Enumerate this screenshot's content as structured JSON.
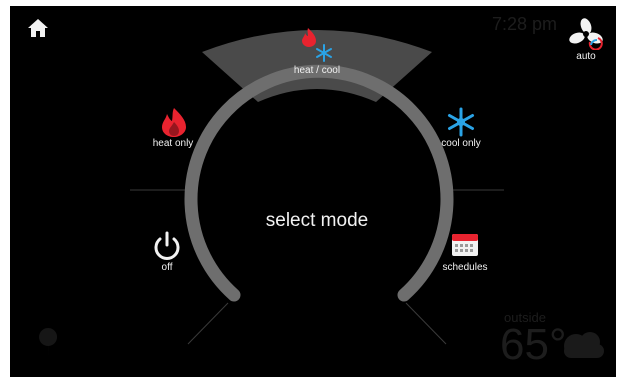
{
  "center_title": "select mode",
  "modes": {
    "heat_cool": "heat / cool",
    "heat_only": "heat only",
    "cool_only": "cool only",
    "off": "off",
    "schedules": "schedules"
  },
  "fan": {
    "label": "auto"
  },
  "background": {
    "time": "7:28 pm",
    "outside_label": "outside",
    "outside_temp": "65°"
  },
  "colors": {
    "background": "#000000",
    "arc": "#6e6e6e",
    "selected_segment": "#4a4a4a",
    "heat": "#e8232f",
    "cool": "#2aa3e6",
    "text": "#f2f2f2"
  },
  "icons": [
    "home-icon",
    "flame-icon",
    "snowflake-icon",
    "power-icon",
    "calendar-icon",
    "fan-icon",
    "weather-icon",
    "location-icon"
  ]
}
